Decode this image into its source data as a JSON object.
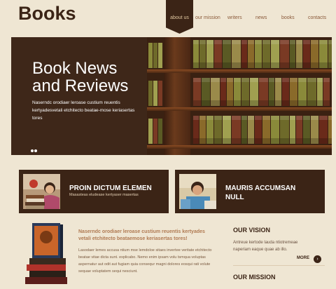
{
  "site": {
    "logo": "Books"
  },
  "nav": {
    "items": [
      {
        "label": "about us",
        "active": true
      },
      {
        "label": "our mission",
        "active": false
      },
      {
        "label": "writers",
        "active": false
      },
      {
        "label": "news",
        "active": false
      },
      {
        "label": "books",
        "active": false
      },
      {
        "label": "contacts",
        "active": false
      }
    ]
  },
  "hero": {
    "title_line1": "Book News",
    "title_line2": "and Reviews",
    "text": "Naserndc orodiaer leroase custium reuentis kertyadesvetali etchitecto beatae-mose keriasertas tores",
    "slides": 2
  },
  "cards": [
    {
      "title": "PROIN DICTUM ELEMEN",
      "subtitle": "Masasteas eludease kertyaser masertas"
    },
    {
      "title_line1": "MAURIS ACCUMSAN",
      "title_line2": "NULL"
    }
  ],
  "about": {
    "title": "Naserndc orodiaer leroase custium reuentis kertyades vetali etchitecto beataemose keriasertas tores!",
    "body": "Lasodaer lemes accusa ntium mse lemdoloe sitaes invertee veritate etchitecto beatae vitae dicta sunt. explicabo. Nemo enim ipsam volu tsmqua voluptas aspernatur aut odit aut fugiam quia consequr magni dolores eosqui rati volute sequae voluptatem sequi nesciunt."
  },
  "sidebar": {
    "vision_heading": "OUR VISION",
    "vision_text": "Antreue kertode lauda ntiotremeae naperiam eaque quae ab illo.",
    "more_label": "MORE",
    "mission_heading": "OUR MISSION"
  },
  "colors": {
    "background": "#efe6d3",
    "dark_brown": "#3b2416",
    "accent": "#b07a52"
  }
}
